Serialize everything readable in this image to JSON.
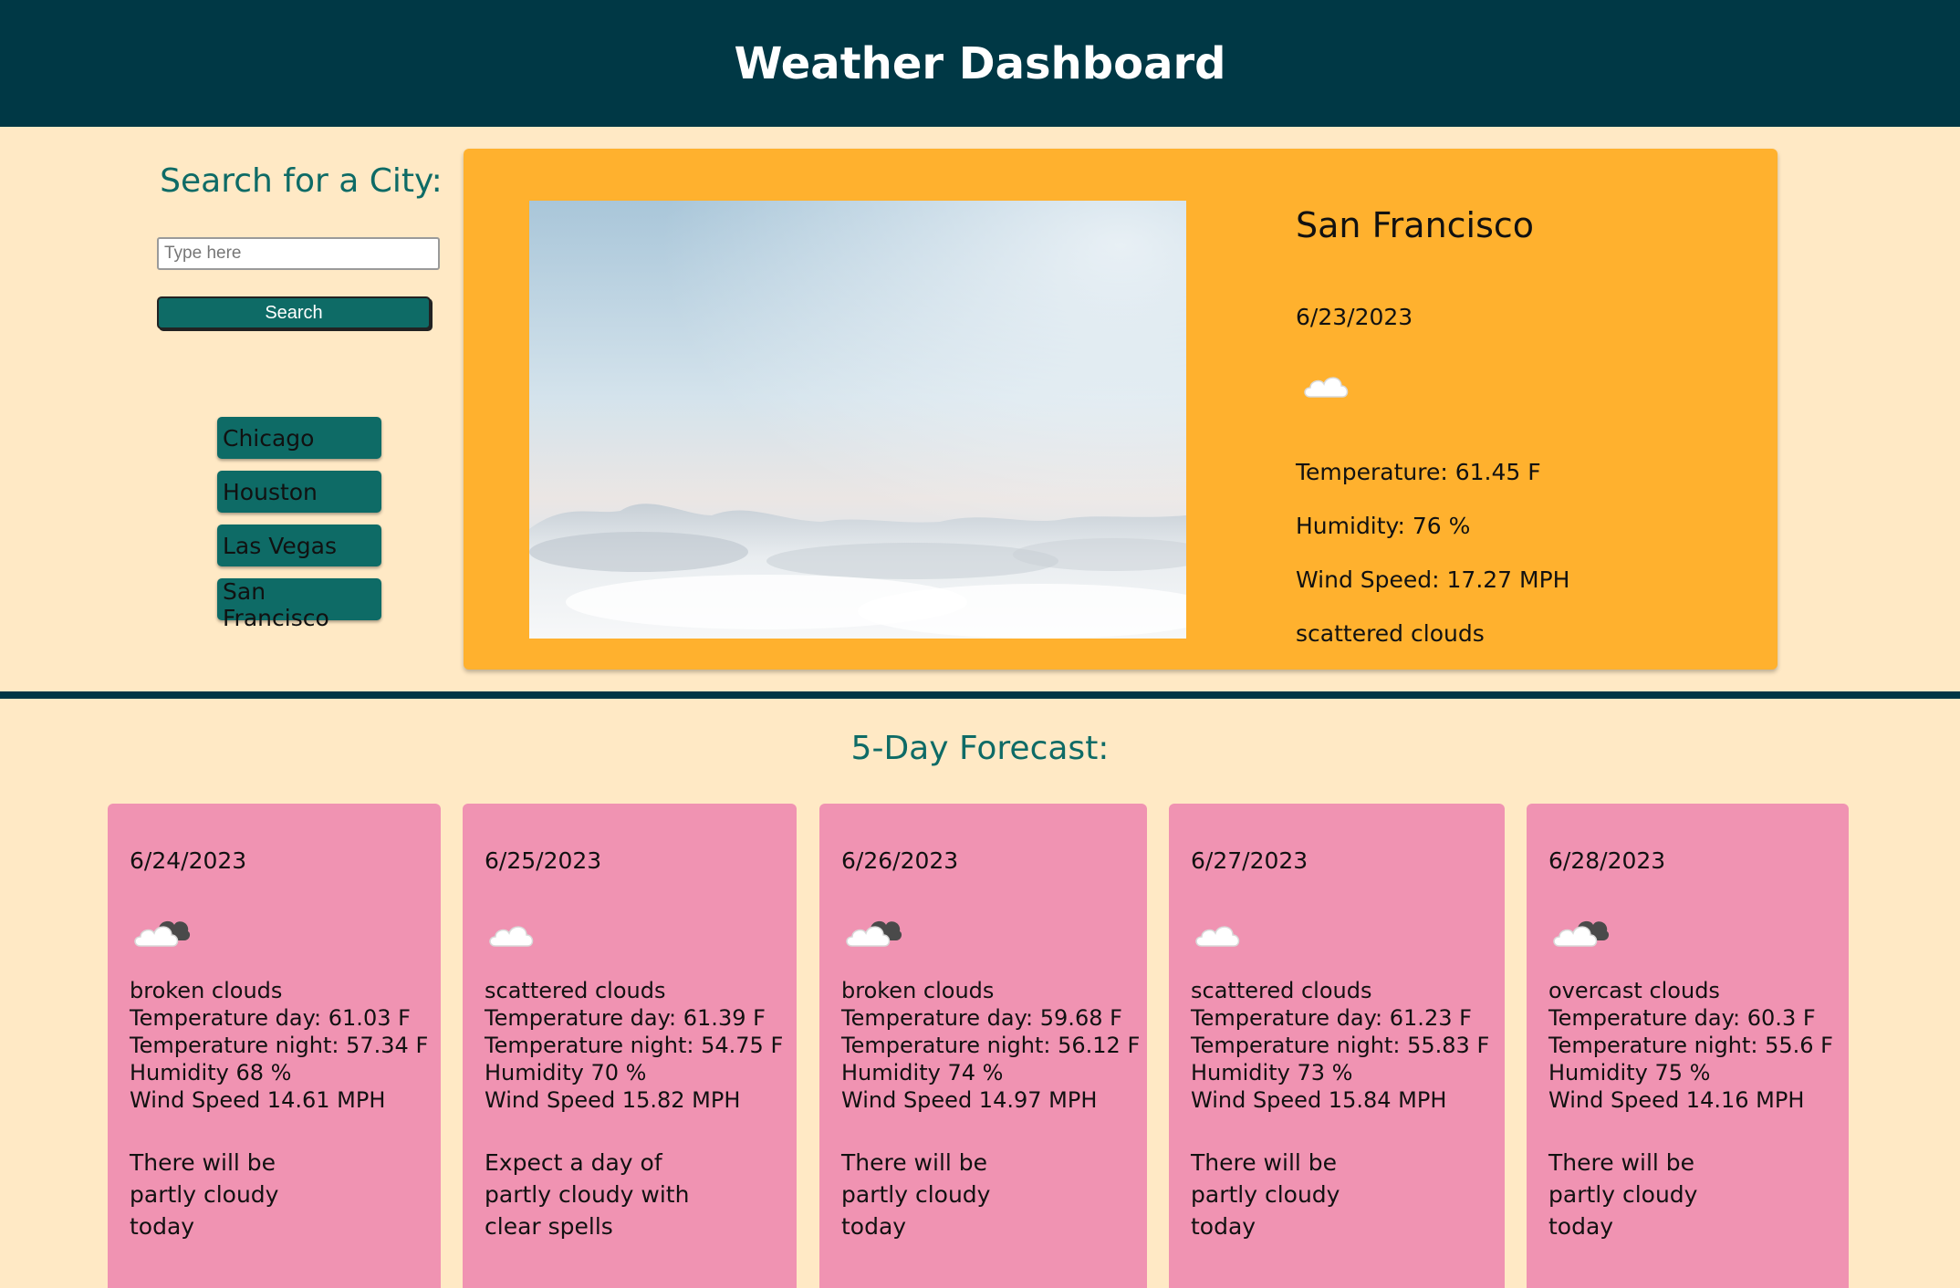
{
  "header": {
    "title": "Weather Dashboard"
  },
  "search": {
    "title": "Search for a City:",
    "placeholder": "Type here",
    "button_label": "Search"
  },
  "history": [
    "Chicago",
    "Houston",
    "Las Vegas",
    "San Francisco"
  ],
  "current": {
    "city": "San Francisco",
    "date": "6/23/2023",
    "icon": "cloud-icon",
    "temperature": "Temperature: 61.45 F",
    "humidity": "Humidity: 76 %",
    "wind": "Wind Speed: 17.27 MPH",
    "description": "scattered clouds"
  },
  "forecast": {
    "title": "5-Day Forecast:",
    "days": [
      {
        "date": "6/24/2023",
        "icon": "broken-clouds-icon",
        "description": "broken clouds",
        "temp_day": "Temperature day: 61.03 F",
        "temp_night": "Temperature night: 57.34 F",
        "humidity": "Humidity 68 %",
        "wind": "Wind Speed 14.61 MPH",
        "summary": "There will be partly cloudy today"
      },
      {
        "date": "6/25/2023",
        "icon": "cloud-icon",
        "description": "scattered clouds",
        "temp_day": "Temperature day: 61.39 F",
        "temp_night": "Temperature night: 54.75 F",
        "humidity": "Humidity 70 %",
        "wind": "Wind Speed 15.82 MPH",
        "summary": "Expect a day of partly cloudy with clear spells"
      },
      {
        "date": "6/26/2023",
        "icon": "broken-clouds-icon",
        "description": "broken clouds",
        "temp_day": "Temperature day: 59.68 F",
        "temp_night": "Temperature night: 56.12 F",
        "humidity": "Humidity 74 %",
        "wind": "Wind Speed 14.97 MPH",
        "summary": "There will be partly cloudy today"
      },
      {
        "date": "6/27/2023",
        "icon": "cloud-icon",
        "description": "scattered clouds",
        "temp_day": "Temperature day: 61.23 F",
        "temp_night": "Temperature night: 55.83 F",
        "humidity": "Humidity 73 %",
        "wind": "Wind Speed 15.84 MPH",
        "summary": "There will be partly cloudy today"
      },
      {
        "date": "6/28/2023",
        "icon": "broken-clouds-icon",
        "description": "overcast clouds",
        "temp_day": "Temperature day: 60.3 F",
        "temp_night": "Temperature night: 55.6 F",
        "humidity": "Humidity 75 %",
        "wind": "Wind Speed 14.16 MPH",
        "summary": "There will be partly cloudy today"
      }
    ]
  },
  "colors": {
    "header_bg": "#003845",
    "page_bg": "#ffe9c5",
    "accent": "#0e6b66",
    "current_card": "#ffb12e",
    "forecast_card": "#f093b2"
  }
}
